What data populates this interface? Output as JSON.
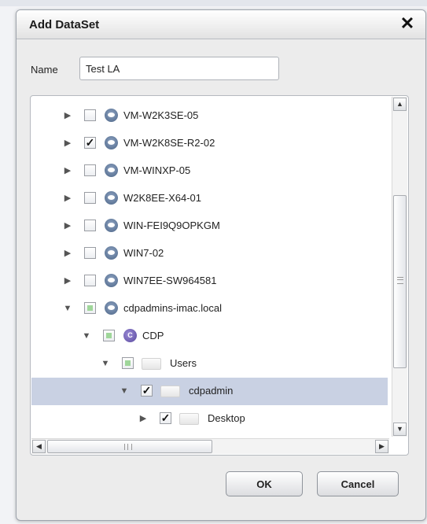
{
  "dialog": {
    "title": "Add DataSet",
    "close_glyph": "✕",
    "name_label": "Name",
    "name_value": "Test LA",
    "ok_label": "OK",
    "cancel_label": "Cancel"
  },
  "tree": {
    "rows": [
      {
        "label": "VM-W2K3SE-05",
        "level": 0,
        "expanded": false,
        "check": "unchecked",
        "icon": "vm-eye-icon",
        "selected": false
      },
      {
        "label": "VM-W2K8SE-R2-02",
        "level": 0,
        "expanded": false,
        "check": "checked",
        "icon": "vm-eye-icon",
        "selected": false
      },
      {
        "label": "VM-WINXP-05",
        "level": 0,
        "expanded": false,
        "check": "unchecked",
        "icon": "vm-eye-icon",
        "selected": false
      },
      {
        "label": "W2K8EE-X64-01",
        "level": 0,
        "expanded": false,
        "check": "unchecked",
        "icon": "vm-eye-icon",
        "selected": false
      },
      {
        "label": "WIN-FEI9Q9OPKGM",
        "level": 0,
        "expanded": false,
        "check": "unchecked",
        "icon": "vm-eye-icon",
        "selected": false
      },
      {
        "label": "WIN7-02",
        "level": 0,
        "expanded": false,
        "check": "unchecked",
        "icon": "vm-eye-icon",
        "selected": false
      },
      {
        "label": "WIN7EE-SW964581",
        "level": 0,
        "expanded": false,
        "check": "unchecked",
        "icon": "vm-eye-icon",
        "selected": false
      },
      {
        "label": "cdpadmins-imac.local",
        "level": 0,
        "expanded": true,
        "check": "partial",
        "icon": "vm-eye-icon",
        "selected": false
      },
      {
        "label": "CDP",
        "level": 1,
        "expanded": true,
        "check": "partial",
        "icon": "cdp-icon",
        "selected": false
      },
      {
        "label": "Users",
        "level": 2,
        "expanded": true,
        "check": "partial",
        "icon": "folder-icon",
        "selected": false
      },
      {
        "label": "cdpadmin",
        "level": 3,
        "expanded": true,
        "check": "checked",
        "icon": "folder-icon",
        "selected": true
      },
      {
        "label": "Desktop",
        "level": 4,
        "expanded": false,
        "check": "checked",
        "icon": "folder-icon",
        "selected": false
      }
    ]
  }
}
